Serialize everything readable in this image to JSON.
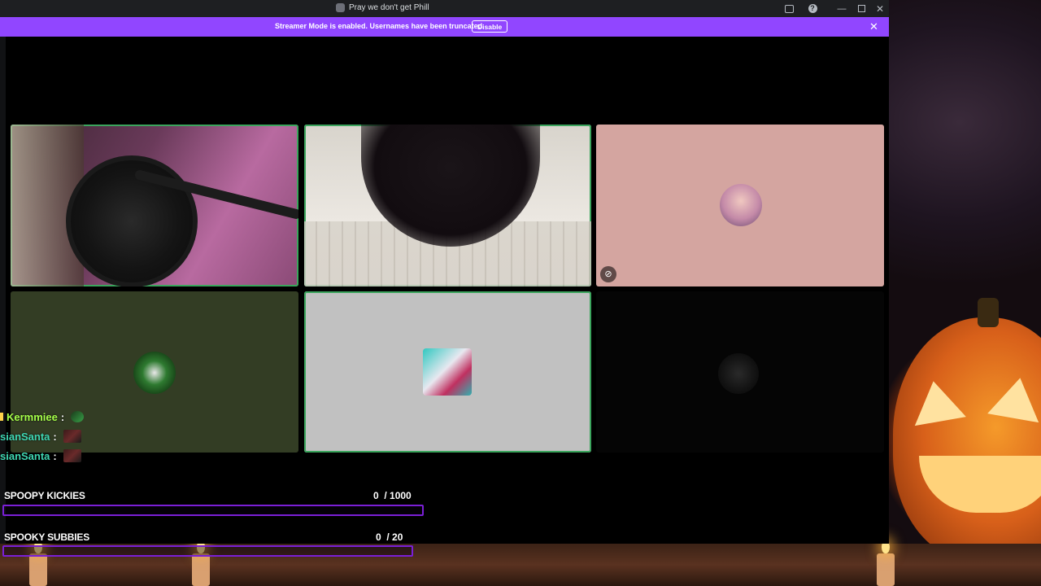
{
  "window": {
    "title": "Pray we don't get Phill",
    "controls": {
      "inbox_icon": "inbox-icon",
      "help_glyph": "?",
      "minimize_glyph": "—",
      "close_glyph": "✕"
    }
  },
  "banner": {
    "text": "Streamer Mode is enabled. Usernames have been truncated.",
    "button_label": "Disable",
    "close_glyph": "✕",
    "color": "#9146ff"
  },
  "tiles": [
    {
      "kind": "webcam",
      "speaking": true
    },
    {
      "kind": "webcam",
      "speaking": true
    },
    {
      "kind": "avatar",
      "speaking": false,
      "bg": "#d4a5a0",
      "muted_video": true
    },
    {
      "kind": "avatar",
      "speaking": false,
      "bg": "#333d24"
    },
    {
      "kind": "avatar",
      "speaking": true,
      "bg": "#c1c1c1"
    },
    {
      "kind": "avatar",
      "speaking": false,
      "bg": "#050505"
    }
  ],
  "chat": [
    {
      "user": "Kermmiee",
      "sep": ":",
      "color": "#a6ff4a"
    },
    {
      "user": "sianSanta",
      "sep": ":",
      "color": "#3fd6b2"
    },
    {
      "user": "sianSanta",
      "sep": ":",
      "color": "#3fd6b2"
    }
  ],
  "goals": [
    {
      "label": "SPOOPY KICKIES",
      "current": "0",
      "target": "/ 1000",
      "progress": 0
    },
    {
      "label": "SPOOKY SUBBIES",
      "current": "0",
      "target": "/ 20",
      "progress": 0
    }
  ],
  "colors": {
    "speaking_outline": "#3ba55d",
    "goal_bar_border": "#7a1fd6"
  }
}
